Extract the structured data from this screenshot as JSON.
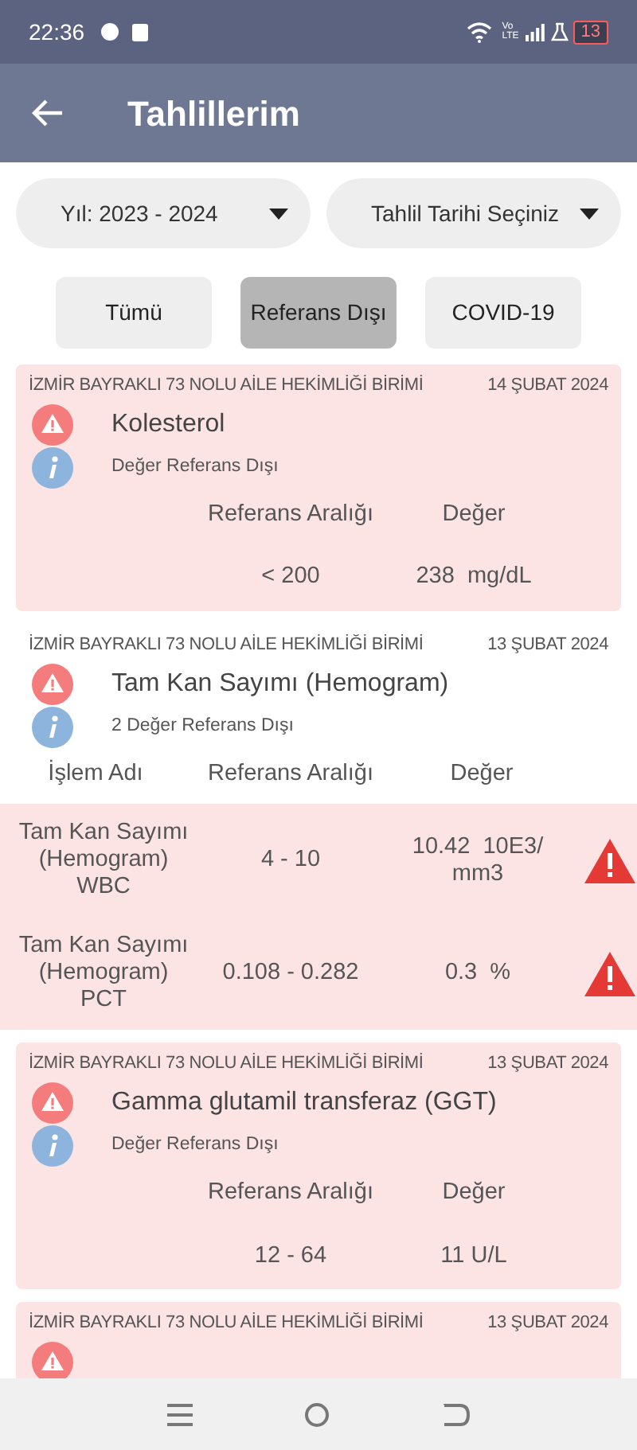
{
  "status_bar": {
    "time": "22:36",
    "volte": [
      "Vo",
      "LTE"
    ],
    "battery": "13"
  },
  "app_bar": {
    "title": "Tahlillerim"
  },
  "filters": [
    {
      "label": "Yıl: 2023 - 2024"
    },
    {
      "label": "Tahlil Tarihi Seçiniz"
    }
  ],
  "tabs": [
    {
      "label": "Tümü",
      "selected": false
    },
    {
      "label": "Referans Dışı",
      "selected": true
    },
    {
      "label": "COVID-19",
      "selected": false
    }
  ],
  "cards": [
    {
      "kind": "single",
      "institution": "İZMİR BAYRAKLI 73 NOLU AİLE HEKİMLİĞİ BİRİMİ",
      "date": "14 ŞUBAT 2024",
      "title": "Kolesterol",
      "note": "Değer Referans Dışı",
      "columns": [
        "Referans Aralığı",
        "Değer"
      ],
      "rows": [
        {
          "range": "< 200",
          "value": "238  mg/dL"
        }
      ]
    },
    {
      "kind": "multi",
      "institution": "İZMİR BAYRAKLI 73 NOLU AİLE HEKİMLİĞİ BİRİMİ",
      "date": "13 ŞUBAT 2024",
      "title": "Tam Kan Sayımı (Hemogram)",
      "note": "2 Değer Referans Dışı",
      "columns": [
        "İşlem Adı",
        "Referans Aralığı",
        "Değer"
      ],
      "rows": [
        {
          "name": "Tam Kan Sayımı (Hemogram) WBC",
          "range": "4 - 10",
          "value": "10.42  10E3/ mm3",
          "out_of_range": true
        },
        {
          "name": "Tam Kan Sayımı (Hemogram) PCT",
          "range": "0.108 - 0.282",
          "value": "0.3  %",
          "out_of_range": true
        }
      ]
    },
    {
      "kind": "single",
      "institution": "İZMİR BAYRAKLI 73 NOLU AİLE HEKİMLİĞİ BİRİMİ",
      "date": "13 ŞUBAT 2024",
      "title": "Gamma glutamil transferaz (GGT)",
      "note": "Değer Referans Dışı",
      "columns": [
        "Referans Aralığı",
        "Değer"
      ],
      "rows": [
        {
          "range": "12 - 64",
          "value": "11 U/L"
        }
      ]
    },
    {
      "kind": "single",
      "institution": "İZMİR BAYRAKLI 73 NOLU AİLE HEKİMLİĞİ BİRİMİ",
      "date": "13 ŞUBAT 2024"
    }
  ]
}
